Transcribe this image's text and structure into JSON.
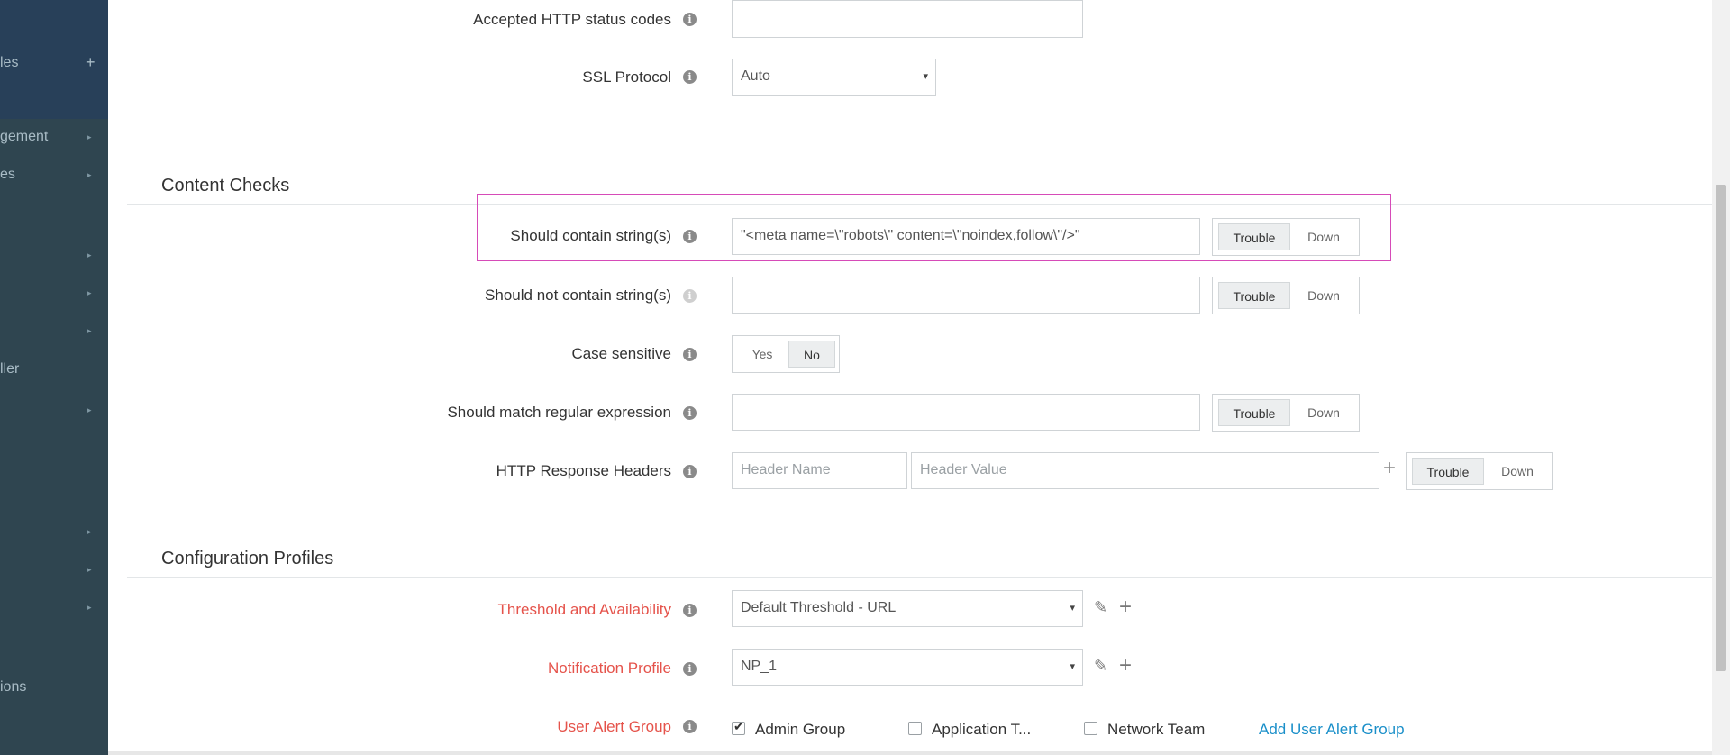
{
  "sidebar": {
    "items": [
      {
        "label": "les",
        "marker": "+"
      },
      {
        "label": "gement",
        "marker": "▸"
      },
      {
        "label": "es",
        "marker": "▸"
      },
      {
        "label": "",
        "marker": "▸"
      },
      {
        "label": "",
        "marker": "▸"
      },
      {
        "label": "",
        "marker": "▸"
      },
      {
        "label": "ller",
        "marker": ""
      },
      {
        "label": "",
        "marker": "▸"
      },
      {
        "label": "",
        "marker": "▸"
      },
      {
        "label": "",
        "marker": "▸"
      },
      {
        "label": "",
        "marker": "▸"
      },
      {
        "label": "ions",
        "marker": ""
      }
    ]
  },
  "form": {
    "accepted_status": {
      "label": "Accepted HTTP status codes",
      "value": ""
    },
    "ssl": {
      "label": "SSL Protocol",
      "value": "Auto"
    },
    "content_checks": {
      "title": "Content Checks",
      "should_contain": {
        "label": "Should contain string(s)",
        "value": "\"<meta name=\\\"robots\\\" content=\\\"noindex,follow\\\"/>\"",
        "opt1": "Trouble",
        "opt2": "Down"
      },
      "should_not_contain": {
        "label": "Should not contain string(s)",
        "value": "",
        "opt1": "Trouble",
        "opt2": "Down"
      },
      "case_sensitive": {
        "label": "Case sensitive",
        "yes": "Yes",
        "no": "No",
        "selected": "No"
      },
      "regex": {
        "label": "Should match regular expression",
        "value": "",
        "opt1": "Trouble",
        "opt2": "Down"
      },
      "headers": {
        "label": "HTTP Response Headers",
        "name_placeholder": "Header Name",
        "value_placeholder": "Header Value",
        "opt1": "Trouble",
        "opt2": "Down"
      }
    },
    "config_profiles": {
      "title": "Configuration Profiles",
      "threshold": {
        "label": "Threshold and Availability",
        "value": "Default Threshold - URL"
      },
      "notification": {
        "label": "Notification Profile",
        "value": "NP_1"
      },
      "alert_group": {
        "label": "User Alert Group",
        "options": [
          {
            "label": "Admin Group",
            "checked": true
          },
          {
            "label": "Application T...",
            "checked": false
          },
          {
            "label": "Network Team",
            "checked": false
          }
        ],
        "add_link": "Add User Alert Group"
      }
    }
  },
  "icons": {
    "info": "info-icon",
    "caret": "▾",
    "plus": "+",
    "edit": "pencil-icon",
    "check": "✔"
  },
  "colors": {
    "sidebar": "#2f4550",
    "required_label": "#e5534b",
    "link": "#1a8fc9",
    "highlight": "#d64bb8"
  }
}
